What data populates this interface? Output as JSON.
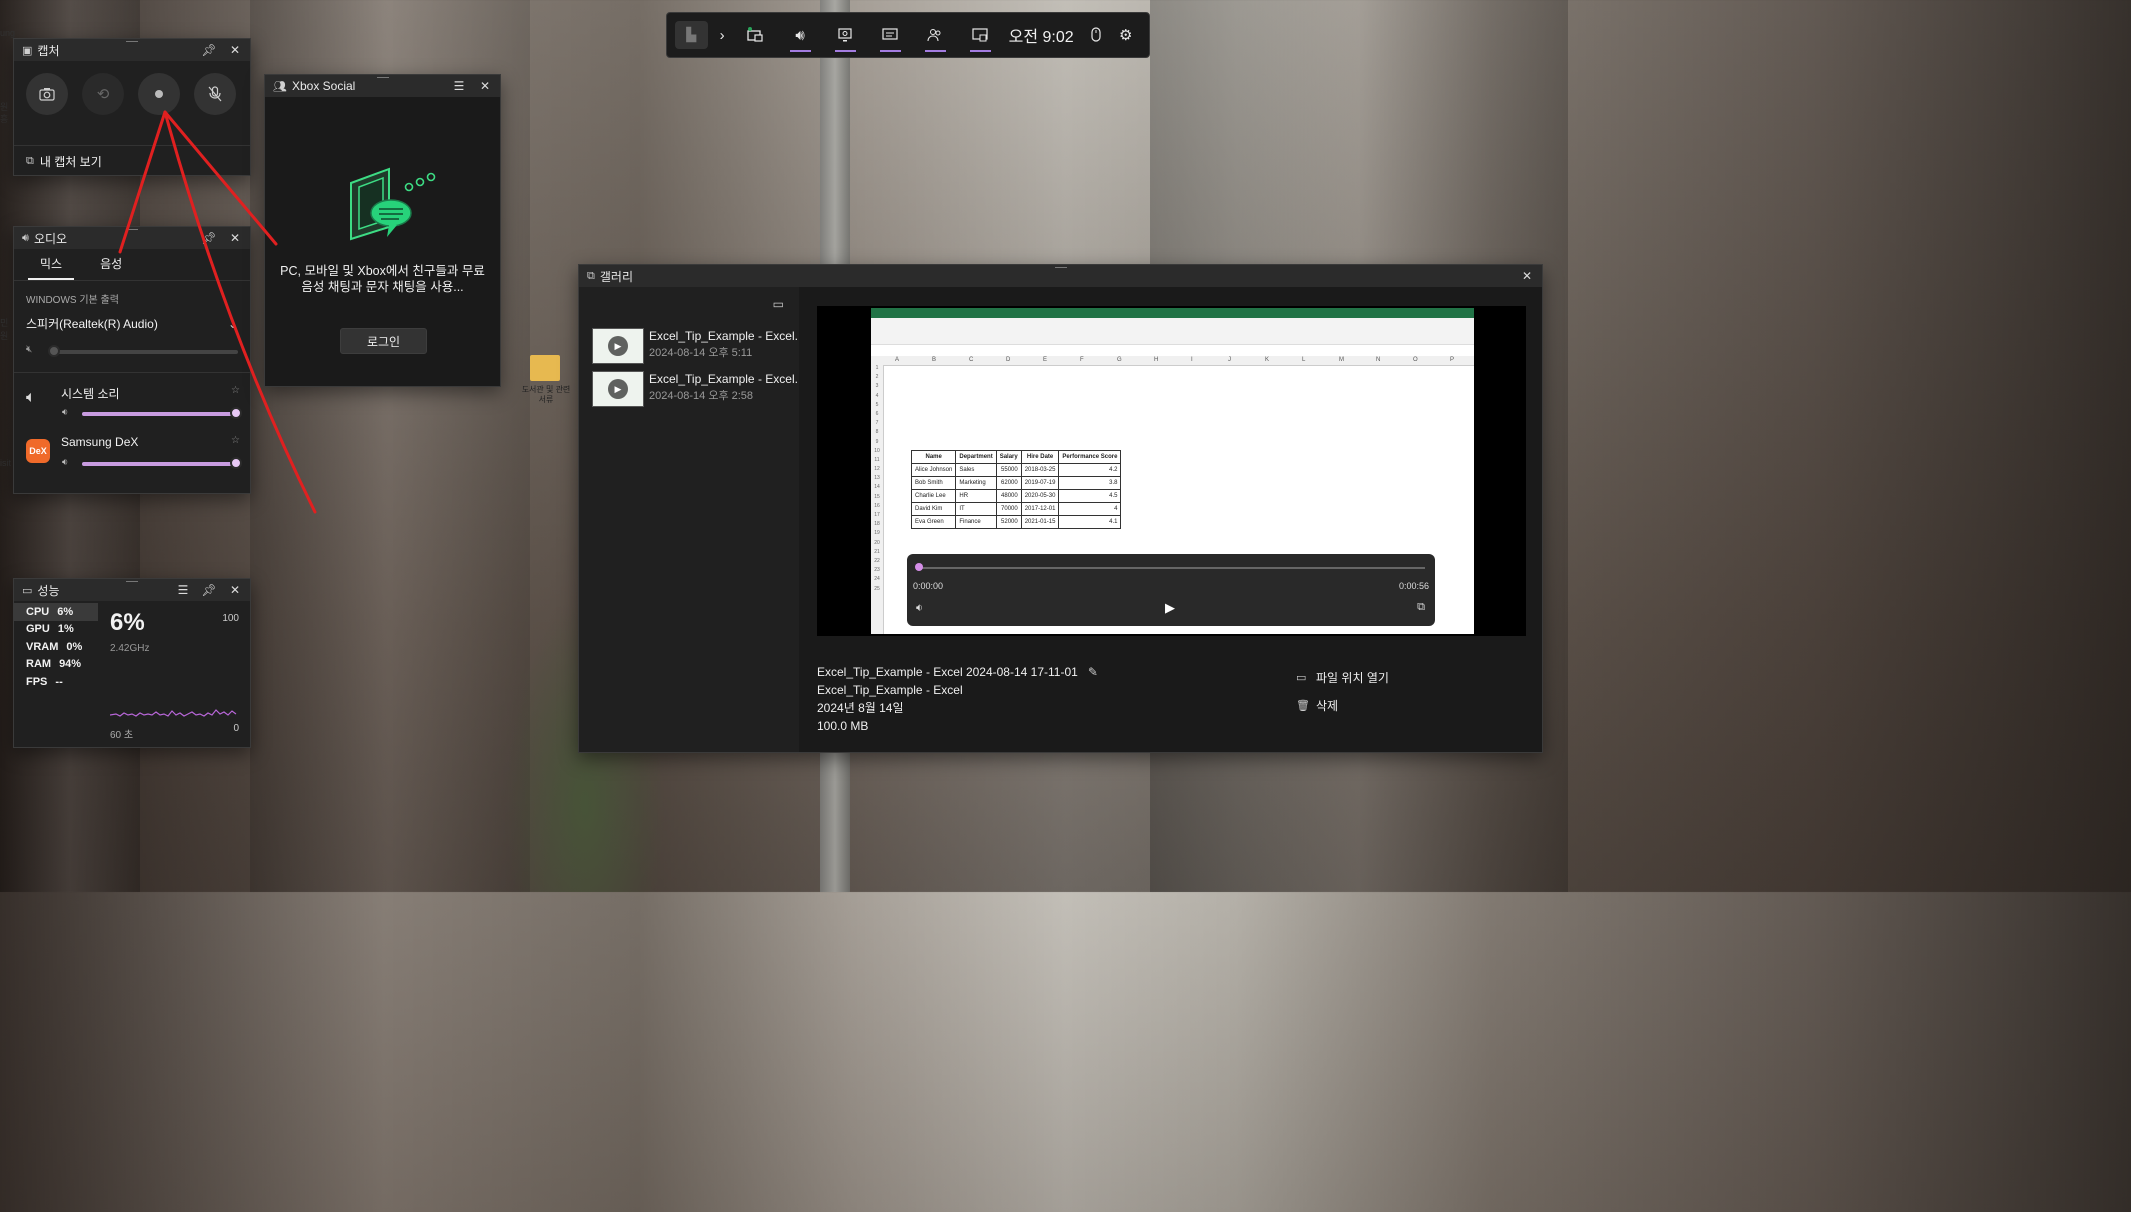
{
  "desktop": {
    "folder_label": "도서관 및 관련서류",
    "edge_texts": [
      "ung",
      "원",
      "흥",
      "민원",
      "isit"
    ]
  },
  "gamebar": {
    "time": "오전 9:02",
    "icons": [
      "widget-home-icon",
      "chevron-right-icon",
      "capture-widget-icon",
      "audio-icon",
      "performance-icon",
      "resources-icon",
      "xbox-social-icon",
      "gallery-icon",
      "mouse-icon",
      "settings-icon"
    ]
  },
  "capture": {
    "title": "캡처",
    "view_label": "내 캡처 보기"
  },
  "audio": {
    "title": "오디오",
    "tabs": [
      "믹스",
      "음성"
    ],
    "output_label": "WINDOWS 기본 출력",
    "device": "스피커(Realtek(R) Audio)",
    "master_level": 0,
    "apps": [
      {
        "name": "시스템 소리",
        "level": 1.0
      },
      {
        "name": "Samsung DeX",
        "level": 1.0,
        "badge": "DeX"
      }
    ]
  },
  "performance": {
    "title": "성능",
    "metrics": [
      {
        "label": "CPU",
        "value": "6%"
      },
      {
        "label": "GPU",
        "value": "1%"
      },
      {
        "label": "VRAM",
        "value": "0%"
      },
      {
        "label": "RAM",
        "value": "94%"
      },
      {
        "label": "FPS",
        "value": "--"
      }
    ],
    "big_value": "6%",
    "freq": "2.42GHz",
    "max": "100",
    "min": "0",
    "window": "60 초"
  },
  "social": {
    "title": "Xbox Social",
    "message": "PC, 모바일 및 Xbox에서 친구들과 무료 음성 채팅과 문자 채팅을 사용...",
    "login": "로그인"
  },
  "gallery": {
    "title": "갤러리",
    "items": [
      {
        "title": "Excel_Tip_Example - Excel...",
        "date": "2024-08-14 오후 5:11"
      },
      {
        "title": "Excel_Tip_Example - Excel...",
        "date": "2024-08-14 오후 2:58"
      }
    ],
    "player": {
      "time_start": "0:00:00",
      "time_end": "0:00:56",
      "progress": 0.0
    },
    "meta": {
      "filename": "Excel_Tip_Example - Excel 2024-08-14 17-11-01",
      "app": "Excel_Tip_Example - Excel",
      "date": "2024년 8월 14일",
      "size": "100.0 MB"
    },
    "actions": {
      "open_location": "파일 위치 열기",
      "delete": "삭제"
    },
    "sheet": {
      "columns": [
        "A",
        "B",
        "C",
        "D",
        "E",
        "F",
        "G",
        "H",
        "I",
        "J",
        "K",
        "L",
        "M",
        "N",
        "O",
        "P"
      ],
      "headers": [
        "Name",
        "Department",
        "Salary",
        "Hire Date",
        "Performance Score"
      ],
      "rows": [
        [
          "Alice Johnson",
          "Sales",
          "55000",
          "2018-03-25",
          "4.2"
        ],
        [
          "Bob Smith",
          "Marketing",
          "62000",
          "2019-07-19",
          "3.8"
        ],
        [
          "Charlie Lee",
          "HR",
          "48000",
          "2020-05-30",
          "4.5"
        ],
        [
          "David Kim",
          "IT",
          "70000",
          "2017-12-01",
          "4"
        ],
        [
          "Eva Green",
          "Finance",
          "52000",
          "2021-01-15",
          "4.1"
        ]
      ]
    }
  }
}
